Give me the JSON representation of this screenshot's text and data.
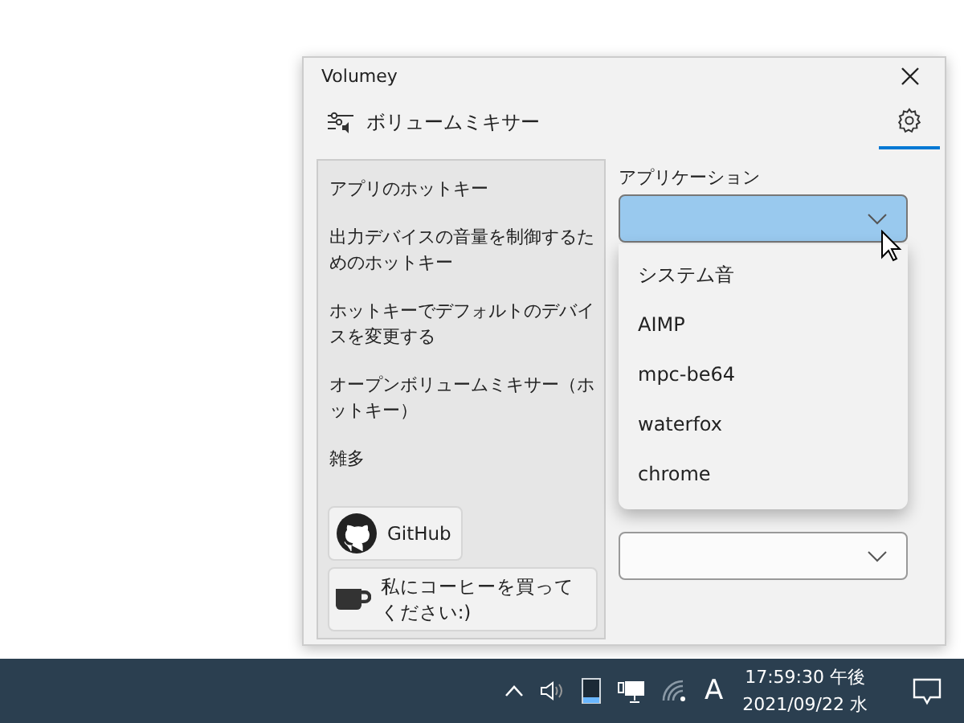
{
  "window": {
    "title": "Volumey"
  },
  "header": {
    "title": "ボリュームミキサー",
    "settings_selected": true
  },
  "sidebar": {
    "items": [
      {
        "label": "アプリのホットキー"
      },
      {
        "label": "出力デバイスの音量を制御するためのホットキー"
      },
      {
        "label": "ホットキーでデフォルトのデバイスを変更する"
      },
      {
        "label": "オープンボリュームミキサー（ホットキー）"
      },
      {
        "label": "雑多"
      }
    ],
    "buttons": [
      {
        "kind": "github",
        "label": "GitHub"
      },
      {
        "kind": "coffee",
        "label": "私にコーヒーを買ってください:)"
      }
    ]
  },
  "application": {
    "label": "アプリケーション",
    "expanded": true,
    "options": [
      {
        "label": "システム音"
      },
      {
        "label": "AIMP"
      },
      {
        "label": "mpc-be64"
      },
      {
        "label": "waterfox"
      },
      {
        "label": "chrome"
      }
    ]
  },
  "taskbar": {
    "ime": "A",
    "time": "17:59:30 午後",
    "date": "2021/09/22 水"
  }
}
